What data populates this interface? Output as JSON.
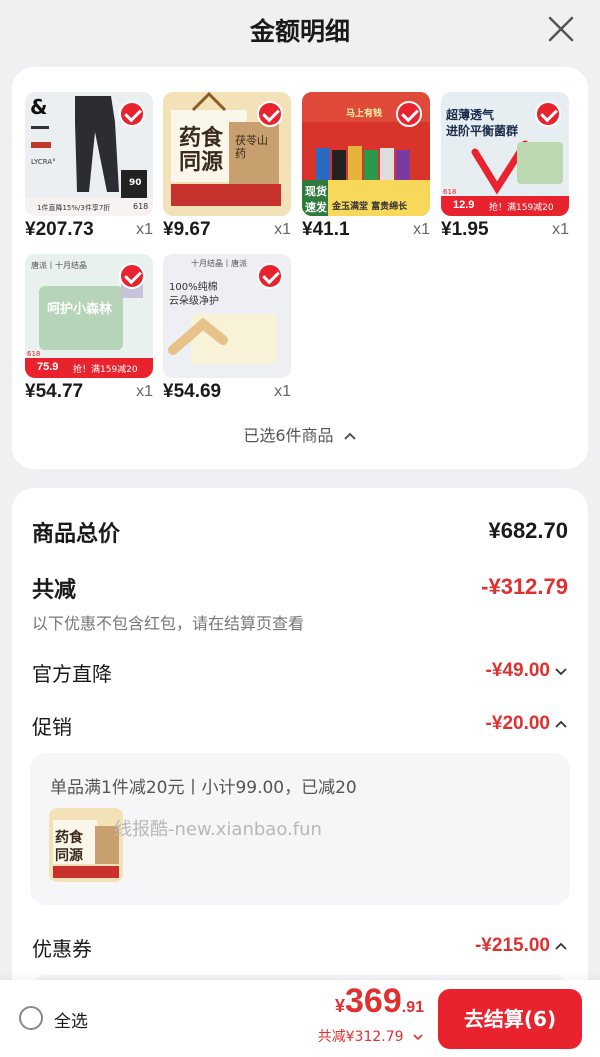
{
  "header": {
    "title": "金额明细"
  },
  "products": [
    {
      "price": "¥207.73",
      "qty": "x1",
      "texts": [
        "LYCRA°",
        "1件直降15%/3件享7折",
        "618",
        "90"
      ]
    },
    {
      "price": "¥9.67",
      "qty": "x1",
      "texts": [
        "药食同源",
        "茯苓山药"
      ]
    },
    {
      "price": "¥41.1",
      "qty": "x1",
      "texts": [
        "马上有钱",
        "现货",
        "速发",
        "金玉满堂 富贵绵长"
      ]
    },
    {
      "price": "¥1.95",
      "qty": "x1",
      "texts": [
        "超薄透气",
        "进阶平衡菌群",
        "12.9",
        "抢！满159减20",
        "618"
      ]
    },
    {
      "price": "¥54.77",
      "qty": "x1",
      "texts": [
        "唐派丨十月结晶",
        "呵护小森林",
        "75.9",
        "抢！满159减20",
        "618"
      ]
    },
    {
      "price": "¥54.69",
      "qty": "x1",
      "texts": [
        "十月结晶丨唐派",
        "100%纯棉",
        "云朵级净护"
      ]
    }
  ],
  "selected_summary": "已选6件商品",
  "summary": {
    "goods_total_label": "商品总价",
    "goods_total": "¥682.70",
    "total_discount_label": "共减",
    "total_discount": "-¥312.79",
    "note": "以下优惠不包含红包，请在结算页查看",
    "official_label": "官方直降",
    "official_value": "-¥49.00",
    "promo_label": "促销",
    "promo_value": "-¥20.00",
    "promo_detail": "单品满1件减20元丨小计99.00，已减20",
    "watermark": "线报酷-new.xianbao.fun",
    "coupon_label": "优惠券",
    "coupon_value": "-¥215.00"
  },
  "bottom": {
    "select_all": "全选",
    "yen": "¥",
    "total_int": "369",
    "total_dec": ".91",
    "saved": "共减¥312.79",
    "checkout": "去结算(6)"
  },
  "colors": {
    "accent": "#e8232d",
    "discount": "#e03131"
  },
  "icons": {
    "close": "close-icon",
    "check": "check-icon",
    "chevron": "chevron-icon",
    "radio": "radio-icon"
  }
}
